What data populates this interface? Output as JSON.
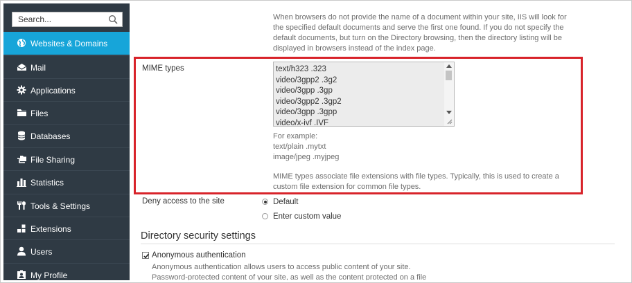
{
  "search": {
    "placeholder": "Search..."
  },
  "sidebar": {
    "items": [
      {
        "label": "Websites & Domains",
        "icon": "globe-icon",
        "active": true
      },
      {
        "label": "Mail",
        "icon": "mail-icon"
      },
      {
        "label": "Applications",
        "icon": "gear-icon"
      },
      {
        "label": "Files",
        "icon": "folder-icon"
      },
      {
        "label": "Databases",
        "icon": "database-icon"
      },
      {
        "label": "File Sharing",
        "icon": "file-sharing-icon"
      },
      {
        "label": "Statistics",
        "icon": "bar-chart-icon"
      },
      {
        "label": "Tools & Settings",
        "icon": "tools-icon"
      },
      {
        "label": "Extensions",
        "icon": "extensions-icon"
      },
      {
        "label": "Users",
        "icon": "user-icon"
      },
      {
        "label": "My Profile",
        "icon": "profile-icon"
      }
    ]
  },
  "main": {
    "default_docs_help": "When browsers do not provide the name of a document within your site, IIS will look for the specified default documents and serve the first one found. If you do not specify the default documents, but turn on the Directory browsing, then the directory listing will be displayed in browsers instead of the index page.",
    "mime": {
      "label": "MIME types",
      "entries": [
        "text/h323 .323",
        "video/3gpp2 .3g2",
        "video/3gpp .3gp",
        "video/3gpp2 .3gp2",
        "video/3gpp .3gpp",
        "video/x-ivf .IVF"
      ],
      "example_title": "For example:",
      "example_lines": [
        "text/plain .mytxt",
        "image/jpeg .myjpeg"
      ],
      "description": "MIME types associate file extensions with file types. Typically, this is used to create a custom file extension for common file types."
    },
    "deny_access": {
      "label": "Deny access to the site",
      "options": [
        {
          "label": "Default",
          "checked": true
        },
        {
          "label": "Enter custom value",
          "checked": false
        }
      ]
    },
    "directory_security": {
      "title": "Directory security settings",
      "anonymous_label": "Anonymous authentication",
      "anonymous_checked": true,
      "help_line1": "Anonymous authentication allows users to access public content of your site.",
      "help_line2": "Password-protected content of your site, as well as the content protected on a file"
    }
  },
  "colors": {
    "sidebar_bg": "#2f3a44",
    "active_item": "#17a5d9",
    "highlight_border": "#d8232a"
  }
}
